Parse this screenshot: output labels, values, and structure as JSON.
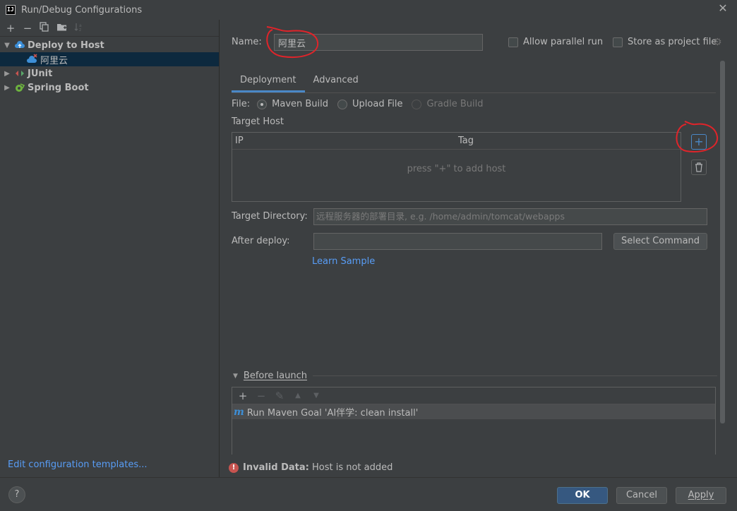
{
  "window": {
    "title": "Run/Debug Configurations",
    "logo_text": "IJ"
  },
  "left_toolbar": {
    "icons": [
      "add-icon",
      "remove-icon",
      "copy-icon",
      "folder-icon",
      "sort-icon"
    ]
  },
  "tree": {
    "items": [
      {
        "label": "Deploy to Host",
        "icon": "deploy-icon",
        "expanded": true
      },
      {
        "label": "阿里云",
        "icon": "deploy-config-icon",
        "selected": true
      },
      {
        "label": "JUnit",
        "icon": "junit-icon"
      },
      {
        "label": "Spring Boot",
        "icon": "spring-boot-icon"
      }
    ]
  },
  "edit_templates_link": "Edit configuration templates...",
  "form": {
    "name_label": "Name:",
    "name_value": "阿里云",
    "allow_parallel_label": "Allow parallel run",
    "store_as_project_label": "Store as project file",
    "tabs": [
      "Deployment",
      "Advanced"
    ],
    "active_tab": "Deployment",
    "file_label": "File:",
    "file_options": [
      {
        "label": "Maven Build",
        "selected": true,
        "enabled": true
      },
      {
        "label": "Upload File",
        "selected": false,
        "enabled": true
      },
      {
        "label": "Gradle Build",
        "selected": false,
        "enabled": false
      }
    ],
    "target_host_label": "Target Host",
    "host_table": {
      "columns": [
        "IP",
        "Tag"
      ],
      "empty_text": "press \"+\" to add host"
    },
    "target_directory_label": "Target Directory:",
    "target_directory_placeholder": "远程服务器的部署目录, e.g. /home/admin/tomcat/webapps",
    "after_deploy_label": "After deploy:",
    "after_deploy_value": "",
    "select_command_label": "Select Command",
    "learn_sample_link": "Learn Sample"
  },
  "before_launch": {
    "title": "Before launch",
    "items": [
      "Run Maven Goal 'AI伴学: clean install'"
    ]
  },
  "status": {
    "bold": "Invalid Data:",
    "text": " Host is not added"
  },
  "buttons": {
    "help": "?",
    "ok": "OK",
    "cancel": "Cancel",
    "apply": "Apply"
  },
  "colors": {
    "accent": "#4a88c7",
    "link": "#589df6",
    "error": "#c75450",
    "annotation": "#e0242a"
  }
}
